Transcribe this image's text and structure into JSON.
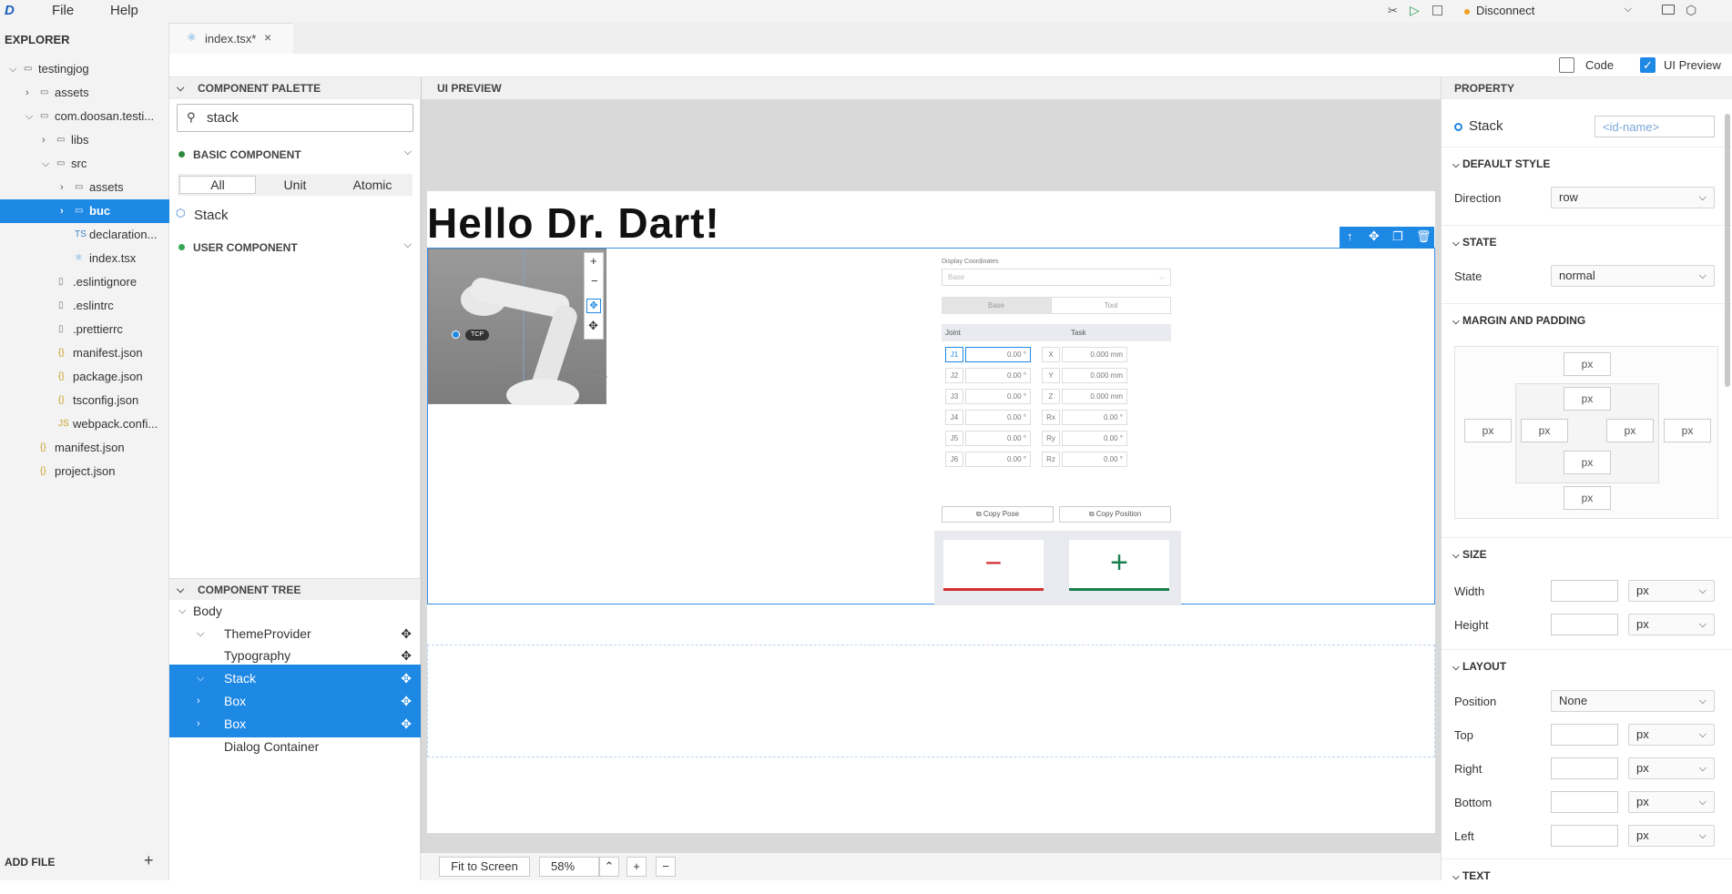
{
  "menubar": {
    "logo": "D",
    "file": "File",
    "help": "Help",
    "connection": "Disconnect"
  },
  "explorer": {
    "title": "EXPLORER",
    "add_file": "ADD FILE",
    "items": [
      {
        "label": "testingjog"
      },
      {
        "label": "assets"
      },
      {
        "label": "com.doosan.testi..."
      },
      {
        "label": "libs"
      },
      {
        "label": "src"
      },
      {
        "label": "assets"
      },
      {
        "label": "buc"
      },
      {
        "label": "declaration..."
      },
      {
        "label": "index.tsx"
      },
      {
        "label": ".eslintignore"
      },
      {
        "label": ".eslintrc"
      },
      {
        "label": ".prettierrc"
      },
      {
        "label": "manifest.json"
      },
      {
        "label": "package.json"
      },
      {
        "label": "tsconfig.json"
      },
      {
        "label": "webpack.confi..."
      },
      {
        "label": "manifest.json"
      },
      {
        "label": "project.json"
      }
    ]
  },
  "tab": {
    "label": "index.tsx*"
  },
  "toggles": {
    "code": "Code",
    "ui_preview": "UI Preview"
  },
  "palette": {
    "title": "COMPONENT PALETTE",
    "search_value": "stack",
    "basic": "BASIC COMPONENT",
    "filters": [
      "All",
      "Unit",
      "Atomic"
    ],
    "result": "Stack",
    "user": "USER COMPONENT"
  },
  "ctree": {
    "title": "COMPONENT TREE",
    "items": [
      {
        "label": "Body"
      },
      {
        "label": "ThemeProvider"
      },
      {
        "label": "Typography"
      },
      {
        "label": "Stack"
      },
      {
        "label": "Box"
      },
      {
        "label": "Box"
      },
      {
        "label": "Dialog Container"
      }
    ]
  },
  "preview": {
    "title": "UI PREVIEW",
    "heading": "Hello Dr. Dart!",
    "tcp": "TCP",
    "jog": {
      "display_coords": "Display Coordinates",
      "base_select": "Base",
      "base_btn": "Base",
      "tool_btn": "Tool",
      "joint_head": "Joint",
      "task_head": "Task",
      "joints": [
        {
          "j": "J1",
          "jv": "0.00 °",
          "t": "X",
          "tv": "0.000 mm"
        },
        {
          "j": "J2",
          "jv": "0.00 °",
          "t": "Y",
          "tv": "0.000 mm"
        },
        {
          "j": "J3",
          "jv": "0.00 °",
          "t": "Z",
          "tv": "0.000 mm"
        },
        {
          "j": "J4",
          "jv": "0.00 °",
          "t": "Rx",
          "tv": "0.00 °"
        },
        {
          "j": "J5",
          "jv": "0.00 °",
          "t": "Ry",
          "tv": "0.00 °"
        },
        {
          "j": "J6",
          "jv": "0.00 °",
          "t": "Rz",
          "tv": "0.00 °"
        }
      ],
      "copy_pose": "Copy Pose",
      "copy_position": "Copy Position"
    },
    "zoom": {
      "fit": "Fit to Screen",
      "level": "58%"
    }
  },
  "property": {
    "title": "PROPERTY",
    "component": "Stack",
    "id_placeholder": "<id-name>",
    "default_style": "DEFAULT STYLE",
    "direction_label": "Direction",
    "direction": "row",
    "state_head": "STATE",
    "state_label": "State",
    "state": "normal",
    "margin_head": "MARGIN AND PADDING",
    "unit": "px",
    "size_head": "SIZE",
    "width_label": "Width",
    "height_label": "Height",
    "layout_head": "LAYOUT",
    "position_label": "Position",
    "position": "None",
    "top_label": "Top",
    "right_label": "Right",
    "bottom_label": "Bottom",
    "left_label": "Left",
    "text_head": "TEXT"
  },
  "colors": {
    "accent": "#1e88e5",
    "minus": "#d32f2f",
    "plus": "#1b7f4f"
  }
}
